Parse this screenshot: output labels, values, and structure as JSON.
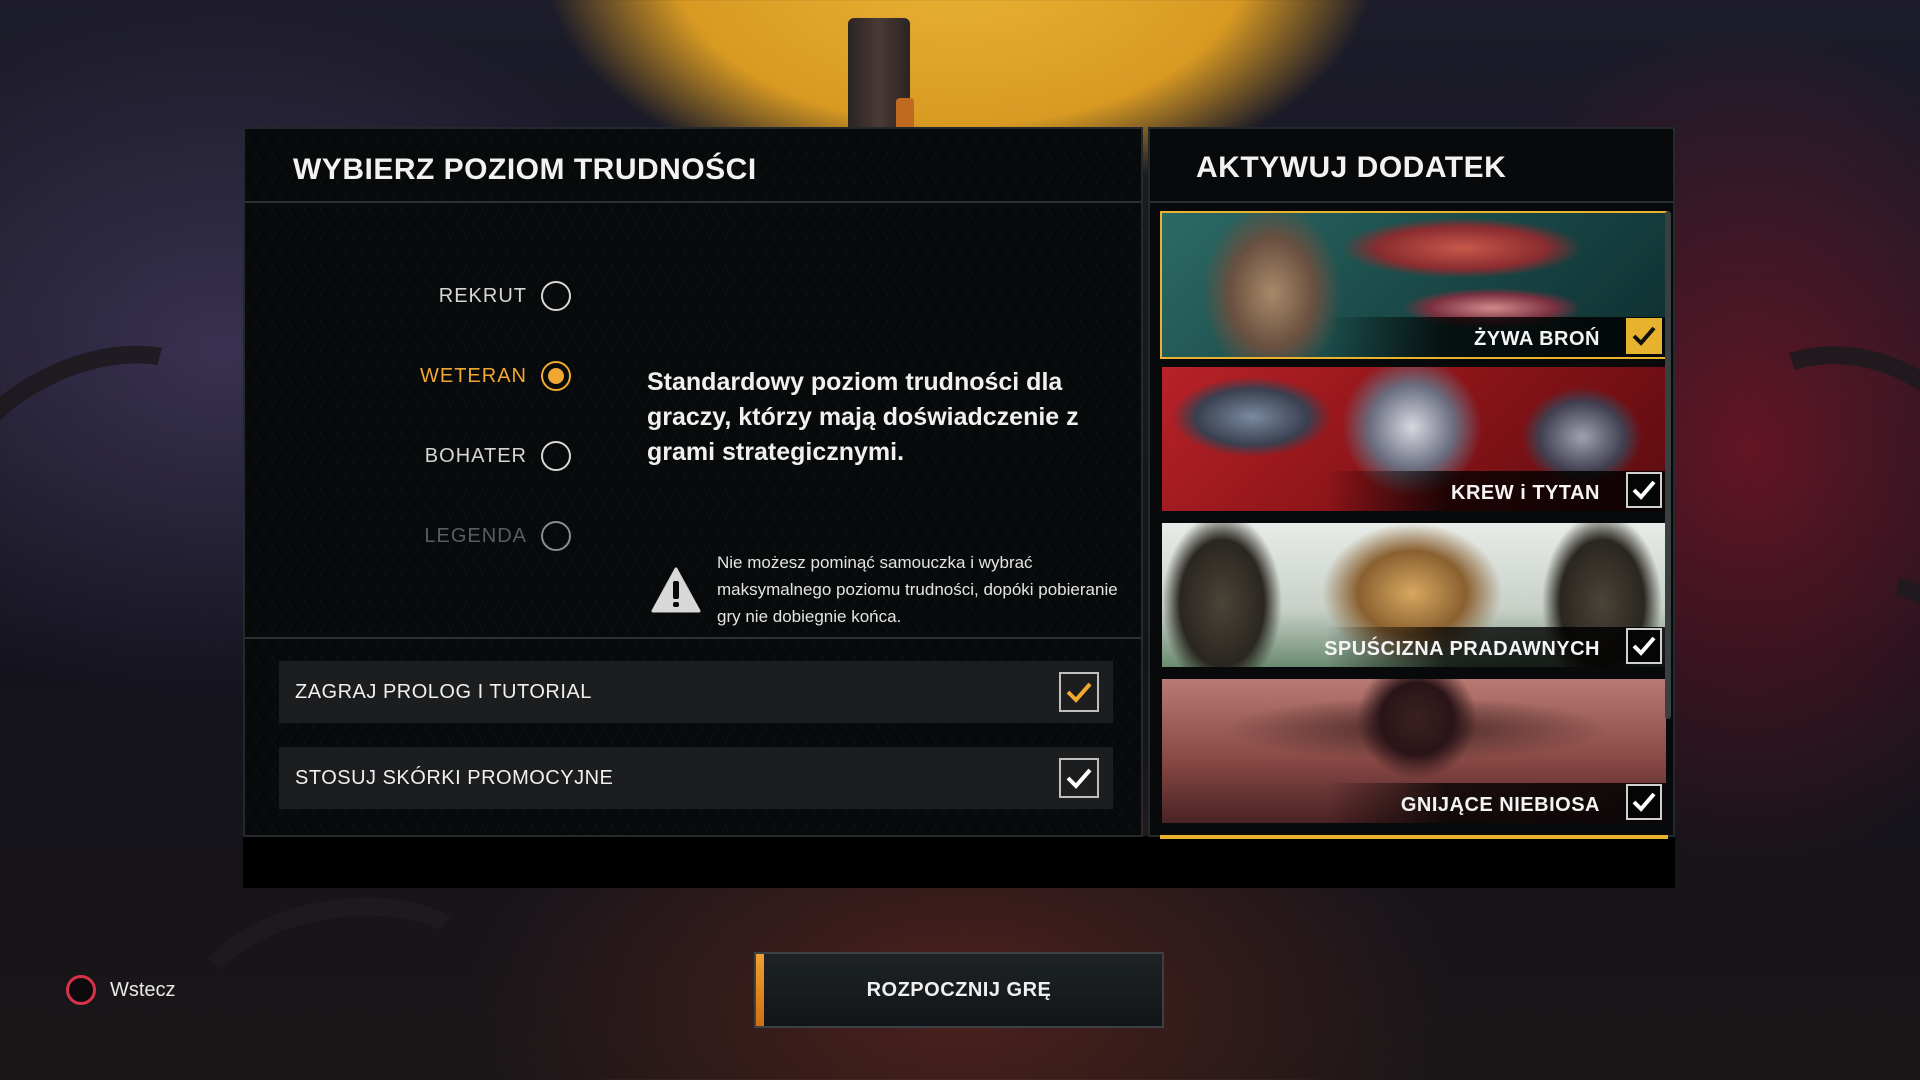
{
  "difficulty_panel": {
    "title": "WYBIERZ POZIOM TRUDNOŚCI",
    "levels": [
      {
        "label": "REKRUT",
        "state": "unselected"
      },
      {
        "label": "WETERAN",
        "state": "selected"
      },
      {
        "label": "BOHATER",
        "state": "unselected"
      },
      {
        "label": "LEGENDA",
        "state": "disabled"
      }
    ],
    "description": "Standardowy poziom trudności dla graczy, którzy mają doświadczenie z grami strategicznymi.",
    "warning": "Nie możesz pominąć samouczka i wybrać maksymalnego poziomu trudności, dopóki pobieranie gry nie dobiegnie końca.",
    "options": [
      {
        "label": "ZAGRAJ PROLOG I TUTORIAL",
        "checked": true,
        "check_color": "#f0a830"
      },
      {
        "label": "STOSUJ SKÓRKI PROMOCYJNE",
        "checked": true,
        "check_color": "#ffffff"
      }
    ]
  },
  "dlc_panel": {
    "title": "AKTYWUJ DODATEK",
    "items": [
      {
        "label": "ŻYWA BROŃ",
        "checked": true,
        "focused": true,
        "icon": "living-weapons-art"
      },
      {
        "label": "KREW i TYTAN",
        "checked": true,
        "focused": false,
        "icon": "blood-titanium-art"
      },
      {
        "label": "SPUŚCIZNA PRADAWNYCH",
        "checked": true,
        "focused": false,
        "icon": "legacy-ancients-art"
      },
      {
        "label": "GNIJĄCE NIEBIOSA",
        "checked": true,
        "focused": false,
        "icon": "rotting-skies-art"
      }
    ]
  },
  "footer": {
    "back_label": "Wstecz",
    "back_icon": "circle-button-icon",
    "start_label": "ROZPOCZNIJ GRĘ"
  },
  "colors": {
    "accent": "#f0a830",
    "focus_border": "#e7b32e",
    "back_circle": "#d8324a"
  }
}
